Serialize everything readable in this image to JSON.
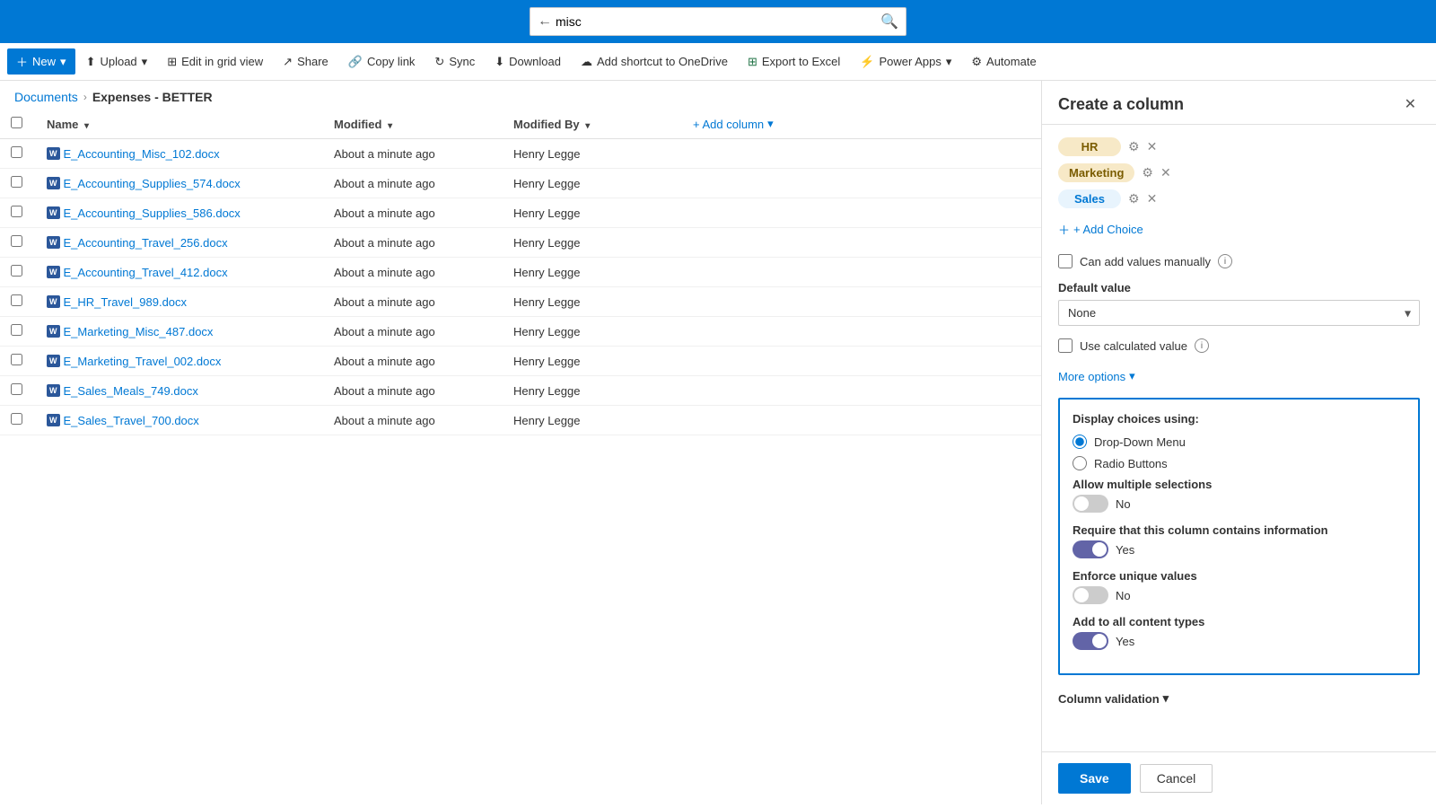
{
  "topbar": {
    "search_value": "misc",
    "search_placeholder": "Search"
  },
  "toolbar": {
    "new_label": "New",
    "upload_label": "Upload",
    "edit_grid_label": "Edit in grid view",
    "share_label": "Share",
    "copy_link_label": "Copy link",
    "sync_label": "Sync",
    "download_label": "Download",
    "add_shortcut_label": "Add shortcut to OneDrive",
    "export_excel_label": "Export to Excel",
    "power_apps_label": "Power Apps",
    "automate_label": "Automate"
  },
  "breadcrumb": {
    "parent": "Documents",
    "current": "Expenses - BETTER"
  },
  "table": {
    "col_check": "",
    "col_name": "Name",
    "col_modified": "Modified",
    "col_modified_by": "Modified By",
    "col_add": "+ Add column",
    "rows": [
      {
        "name": "E_Accounting_Misc_102.docx",
        "modified": "About a minute ago",
        "modified_by": "Henry Legge"
      },
      {
        "name": "E_Accounting_Supplies_574.docx",
        "modified": "About a minute ago",
        "modified_by": "Henry Legge"
      },
      {
        "name": "E_Accounting_Supplies_586.docx",
        "modified": "About a minute ago",
        "modified_by": "Henry Legge"
      },
      {
        "name": "E_Accounting_Travel_256.docx",
        "modified": "About a minute ago",
        "modified_by": "Henry Legge"
      },
      {
        "name": "E_Accounting_Travel_412.docx",
        "modified": "About a minute ago",
        "modified_by": "Henry Legge"
      },
      {
        "name": "E_HR_Travel_989.docx",
        "modified": "About a minute ago",
        "modified_by": "Henry Legge"
      },
      {
        "name": "E_Marketing_Misc_487.docx",
        "modified": "About a minute ago",
        "modified_by": "Henry Legge"
      },
      {
        "name": "E_Marketing_Travel_002.docx",
        "modified": "About a minute ago",
        "modified_by": "Henry Legge"
      },
      {
        "name": "E_Sales_Meals_749.docx",
        "modified": "About a minute ago",
        "modified_by": "Henry Legge"
      },
      {
        "name": "E_Sales_Travel_700.docx",
        "modified": "About a minute ago",
        "modified_by": "Henry Legge"
      }
    ]
  },
  "panel": {
    "title": "Create a column",
    "choices": [
      {
        "label": "HR",
        "style": "hr"
      },
      {
        "label": "Marketing",
        "style": "marketing"
      },
      {
        "label": "Sales",
        "style": "sales"
      }
    ],
    "add_choice_label": "+ Add Choice",
    "can_add_values_label": "Can add values manually",
    "default_value_label": "Default value",
    "default_value_options": [
      "None"
    ],
    "default_value_selected": "None",
    "use_calculated_label": "Use calculated value",
    "more_options_label": "More options",
    "more_options_expanded": true,
    "display_choices_label": "Display choices using:",
    "radio_dropdown": "Drop-Down Menu",
    "radio_buttons": "Radio Buttons",
    "allow_multiple_label": "Allow multiple selections",
    "allow_multiple_value": "No",
    "allow_multiple_on": false,
    "require_column_label": "Require that this column contains information",
    "require_column_value": "Yes",
    "require_column_on": true,
    "enforce_unique_label": "Enforce unique values",
    "enforce_unique_value": "No",
    "enforce_unique_on": false,
    "add_all_content_label": "Add to all content types",
    "add_all_content_value": "Yes",
    "add_all_content_on": true,
    "col_validation_label": "Column validation",
    "save_label": "Save",
    "cancel_label": "Cancel"
  }
}
